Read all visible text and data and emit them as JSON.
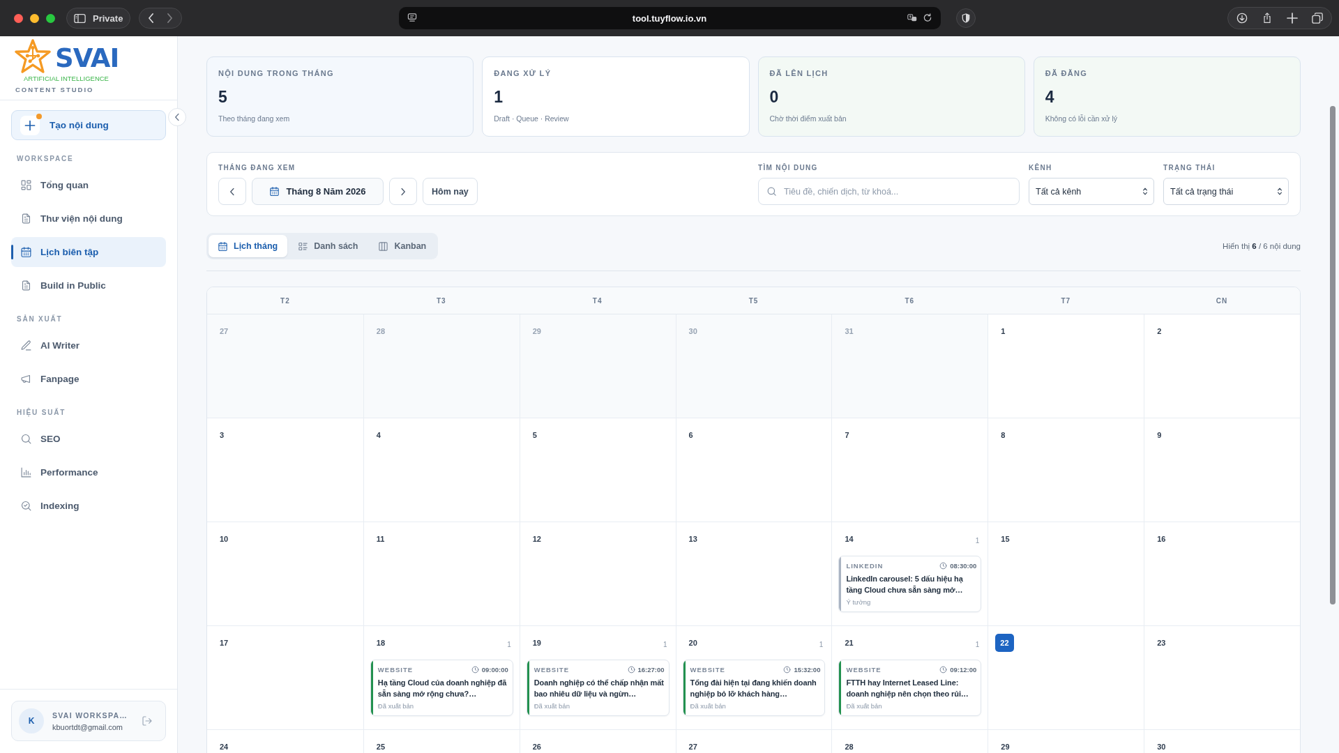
{
  "browser": {
    "sidebar_label": "Private",
    "url": "tool.tuyflow.io.vn"
  },
  "sidebar": {
    "logo": {
      "wordmark": "SVAI",
      "tagline": "ARTIFICIAL INTELLIGENCE",
      "product": "CONTENT STUDIO"
    },
    "create_button": {
      "label": "Tạo nội dung",
      "notification": true
    },
    "sections": [
      {
        "title": "WORKSPACE",
        "items": [
          {
            "label": "Tổng quan",
            "selected": false
          },
          {
            "label": "Thư viện nội dung",
            "selected": false
          },
          {
            "label": "Lịch biên tập",
            "selected": true
          },
          {
            "label": "Build in Public",
            "selected": false
          }
        ]
      },
      {
        "title": "SẢN XUẤT",
        "items": [
          {
            "label": "AI Writer",
            "selected": false
          },
          {
            "label": "Fanpage",
            "selected": false
          }
        ]
      },
      {
        "title": "HIỆU SUẤT",
        "items": [
          {
            "label": "SEO",
            "selected": false
          },
          {
            "label": "Performance",
            "selected": false
          },
          {
            "label": "Indexing",
            "selected": false
          }
        ]
      }
    ],
    "user": {
      "initial": "K",
      "name": "SVAI WORKSPA…",
      "email": "kbuortdt@gmail.com"
    }
  },
  "stats": [
    {
      "label": "NỘI DUNG TRONG THÁNG",
      "value": "5",
      "note": "Theo tháng đang xem",
      "color": "#f4f8fd"
    },
    {
      "label": "ĐANG XỬ LÝ",
      "value": "1",
      "note": "Draft · Queue · Review",
      "color": "#ffffff"
    },
    {
      "label": "ĐÃ LÊN LỊCH",
      "value": "0",
      "note": "Chờ thời điểm xuất bản",
      "color": "#f3f9f5"
    },
    {
      "label": "ĐÃ ĐĂNG",
      "value": "4",
      "note": "Không có lỗi cần xử lý",
      "color": "#f3f9f5"
    }
  ],
  "filters": {
    "month": {
      "label": "THÁNG ĐANG XEM",
      "value": "Tháng 8 Năm 2026",
      "today_button": "Hôm nay"
    },
    "search": {
      "label": "TÌM NỘI DUNG",
      "placeholder": "Tiêu đề, chiến dịch, từ khoá..."
    },
    "channel": {
      "label": "KÊNH",
      "value": "Tất cả kênh"
    },
    "status": {
      "label": "TRẠNG THÁI",
      "value": "Tất cả trạng thái"
    }
  },
  "views": {
    "tabs": [
      {
        "label": "Lịch tháng",
        "selected": true
      },
      {
        "label": "Danh sách",
        "selected": false
      },
      {
        "label": "Kanban",
        "selected": false
      }
    ],
    "result_count": "Hiển thị **6** / 6 nội dung"
  },
  "calendar": {
    "weekdays": [
      "T2",
      "T3",
      "T4",
      "T5",
      "T6",
      "T7",
      "CN"
    ],
    "weeks": [
      [
        {
          "day": "27",
          "in_month": false,
          "today": false
        },
        {
          "day": "28",
          "in_month": false,
          "today": false
        },
        {
          "day": "29",
          "in_month": false,
          "today": false
        },
        {
          "day": "30",
          "in_month": false,
          "today": false
        },
        {
          "day": "31",
          "in_month": false,
          "today": false
        },
        {
          "day": "1",
          "in_month": true,
          "today": false
        },
        {
          "day": "2",
          "in_month": true,
          "today": false
        }
      ],
      [
        {
          "day": "3",
          "in_month": true,
          "today": false
        },
        {
          "day": "4",
          "in_month": true,
          "today": false
        },
        {
          "day": "5",
          "in_month": true,
          "today": false
        },
        {
          "day": "6",
          "in_month": true,
          "today": false
        },
        {
          "day": "7",
          "in_month": true,
          "today": false
        },
        {
          "day": "8",
          "in_month": true,
          "today": false
        },
        {
          "day": "9",
          "in_month": true,
          "today": false
        }
      ],
      [
        {
          "day": "10",
          "in_month": true,
          "today": false
        },
        {
          "day": "11",
          "in_month": true,
          "today": false
        },
        {
          "day": "12",
          "in_month": true,
          "today": false
        },
        {
          "day": "13",
          "in_month": true,
          "today": false
        },
        {
          "day": "14",
          "in_month": true,
          "today": false,
          "count": "1",
          "events": [
            {
              "channel": "LINKEDIN",
              "time": "08:30:00",
              "title": "LinkedIn carousel: 5 dấu hiệu hạ tầng Cloud chưa sẵn sàng mở…",
              "status": "Ý tưởng",
              "color": "#aab4c3"
            }
          ]
        },
        {
          "day": "15",
          "in_month": true,
          "today": false
        },
        {
          "day": "16",
          "in_month": true,
          "today": false
        }
      ],
      [
        {
          "day": "17",
          "in_month": true,
          "today": false
        },
        {
          "day": "18",
          "in_month": true,
          "today": false,
          "count": "1",
          "events": [
            {
              "channel": "WEBSITE",
              "time": "09:00:00",
              "title": "Hạ tầng Cloud của doanh nghiệp đã sẵn sàng mở rộng chưa?…",
              "status": "Đã xuất bản",
              "color": "#23914f"
            }
          ]
        },
        {
          "day": "19",
          "in_month": true,
          "today": false,
          "count": "1",
          "events": [
            {
              "channel": "WEBSITE",
              "time": "16:27:00",
              "title": "Doanh nghiệp có thể chấp nhận mất bao nhiêu dữ liệu và ngừn…",
              "status": "Đã xuất bản",
              "color": "#23914f"
            }
          ]
        },
        {
          "day": "20",
          "in_month": true,
          "today": false,
          "count": "1",
          "events": [
            {
              "channel": "WEBSITE",
              "time": "15:32:00",
              "title": "Tổng đài hiện tại đang khiến doanh nghiệp bỏ lỡ khách hàng…",
              "status": "Đã xuất bản",
              "color": "#23914f"
            }
          ]
        },
        {
          "day": "21",
          "in_month": true,
          "today": false,
          "count": "1",
          "events": [
            {
              "channel": "WEBSITE",
              "time": "09:12:00",
              "title": "FTTH hay Internet Leased Line: doanh nghiệp nên chọn theo rủi…",
              "status": "Đã xuất bản",
              "color": "#23914f"
            }
          ]
        },
        {
          "day": "22",
          "in_month": true,
          "today": true
        },
        {
          "day": "23",
          "in_month": true,
          "today": false
        }
      ],
      [
        {
          "day": "24",
          "in_month": true,
          "today": false
        },
        {
          "day": "25",
          "in_month": true,
          "today": false
        },
        {
          "day": "26",
          "in_month": true,
          "today": false
        },
        {
          "day": "27",
          "in_month": true,
          "today": false
        },
        {
          "day": "28",
          "in_month": true,
          "today": false
        },
        {
          "day": "29",
          "in_month": true,
          "today": false
        },
        {
          "day": "30",
          "in_month": true,
          "today": false
        }
      ]
    ]
  }
}
